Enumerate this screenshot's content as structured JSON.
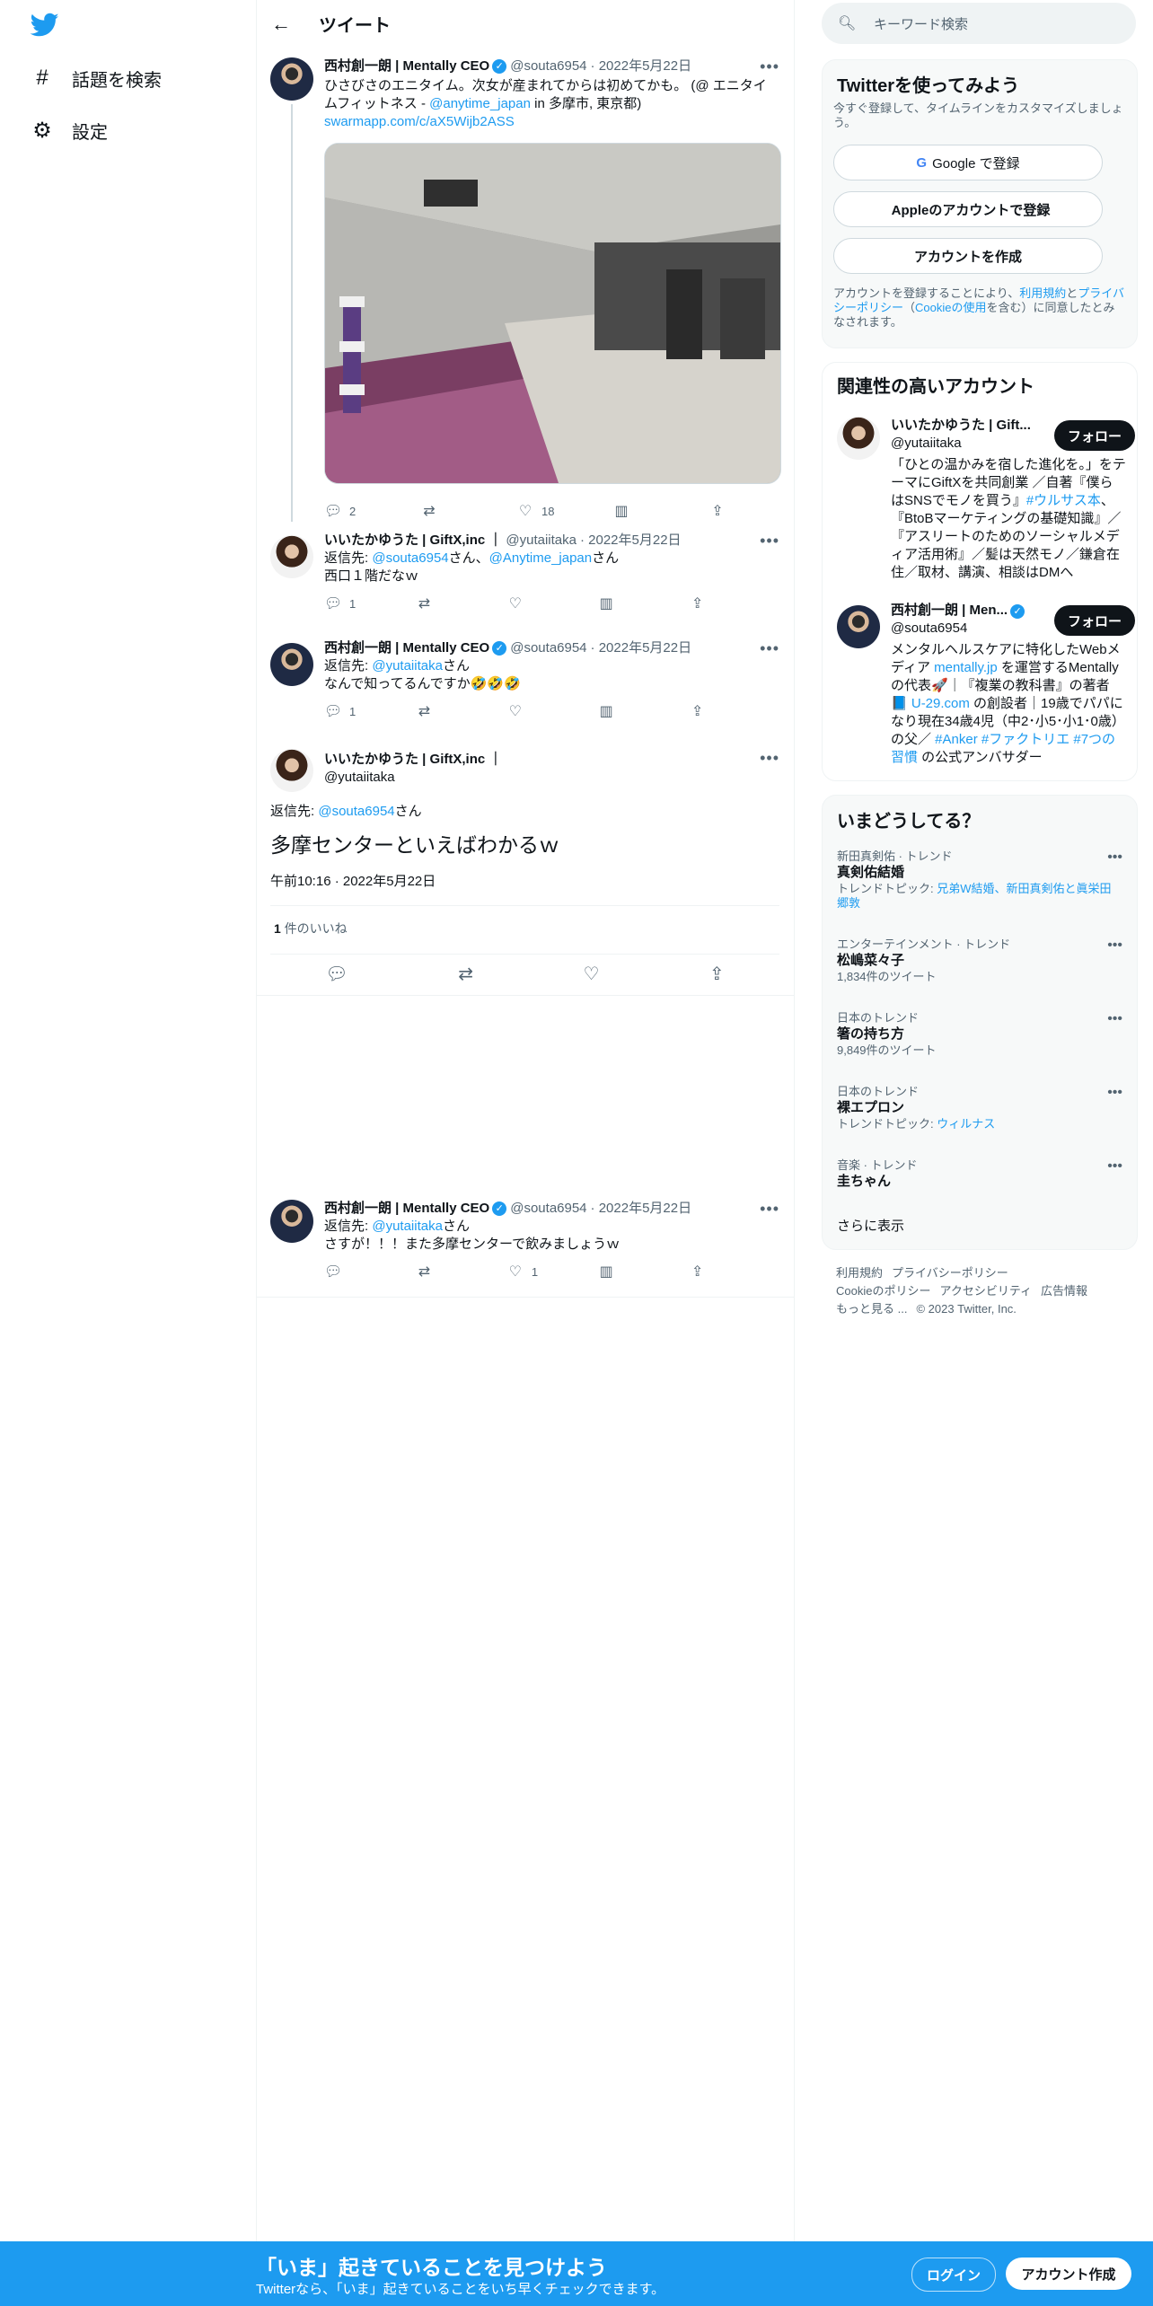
{
  "nav": {
    "items": [
      {
        "label": "話題を検索",
        "icon": "hashtag-icon"
      },
      {
        "label": "設定",
        "icon": "gear-icon"
      }
    ]
  },
  "header": {
    "title": "ツイート"
  },
  "tweets": [
    {
      "name": "西村創一朗 | Mentally CEO",
      "handle": "@souta6954",
      "date": "· 2022年5月22日",
      "text_1": "ひさびさのエニタイム。次女が産まれてからは初めてかも。 (@ エニタイムフィットネス - ",
      "mention": "@anytime_japan",
      "text_2": " in 多摩市, 東京都)",
      "link": "swarmapp.com/c/aX5Wijb2ASS",
      "reply_count": "2",
      "retweet_count": "",
      "like_count": "18"
    },
    {
      "name": "いいたかゆうた | GiftX,inc ｜",
      "handle": "@yutaiitaka",
      "date": "· 2022年5月22日",
      "reply_prefix": "返信先: ",
      "reply_to_1": "@souta6954",
      "reply_mid": "さん、",
      "reply_to_2": "@Anytime_japan",
      "reply_suffix": "さん",
      "text": "西口１階だなｗ",
      "reply_count": "1",
      "retweet_count": "",
      "like_count": ""
    },
    {
      "name": "西村創一朗 | Mentally CEO",
      "handle": "@souta6954",
      "date": "· 2022年5月22日",
      "reply_prefix": "返信先: ",
      "reply_to_1": "@yutaiitaka",
      "reply_suffix": "さん",
      "text": "なんで知ってるんですか🤣🤣🤣",
      "reply_count": "1",
      "retweet_count": "",
      "like_count": ""
    },
    {
      "name": "西村創一朗 | Mentally CEO",
      "handle": "@souta6954",
      "date": "· 2022年5月22日",
      "reply_prefix": "返信先: ",
      "reply_to_1": "@yutaiitaka",
      "reply_suffix": "さん",
      "text": "さすが！！！また多摩センターで飲みましょうｗ",
      "reply_count": "",
      "retweet_count": "",
      "like_count": "1"
    }
  ],
  "focus": {
    "name": "いいたかゆうた | GiftX,inc ｜",
    "handle": "@yutaiitaka",
    "reply_prefix": "返信先: ",
    "reply_to": "@souta6954",
    "reply_suffix": "さん",
    "text": "多摩センターといえばわかるｗ",
    "timestamp": "午前10:16 · 2022年5月22日",
    "like_count": "1",
    "like_label": " 件のいいね"
  },
  "sidebar": {
    "search_placeholder": "キーワード検索",
    "signup": {
      "title": "Twitterを使ってみよう",
      "subtitle": "今すぐ登録して、タイムラインをカスタマイズしましょう。",
      "google_label": "Google で登録",
      "apple_label": "Appleのアカウントで登録",
      "create_label": "アカウントを作成",
      "terms_1": "アカウントを登録することにより、",
      "terms_link_1": "利用規約",
      "terms_2": "と",
      "terms_link_2": "プライバシーポリシー",
      "terms_3": "（",
      "terms_link_3": "Cookieの使用",
      "terms_4": "を含む）に同意したとみなされます。"
    },
    "related": {
      "title": "関連性の高いアカウント",
      "follow_label": "フォロー",
      "accounts": [
        {
          "name": "いいたかゆうた | Gift...",
          "handle": "@yutaiitaka",
          "bio_1": "「ひとの温かみを宿した進化を。」をテーマにGiftXを共同創業 ／自著『僕らはSNSでモノを買う』",
          "bio_tag": "#ウルサス本",
          "bio_2": "、『BtoBマーケティングの基礎知識』／『アスリートのためのソーシャルメディア活用術』／髪は天然モノ／鎌倉在住／取材、講演、相談はDMへ"
        },
        {
          "name": "西村創一朗 | Men...",
          "handle": "@souta6954",
          "bio_1": "メンタルヘルスケアに特化したWebメディア ",
          "bio_link_1": "mentally.jp",
          "bio_2": " を運営するMentallyの代表🚀｜『複業の教科書』の著者📘 ",
          "bio_link_2": "U-29.com",
          "bio_3": " の創設者｜19歳でパパになり現在34歳4児（中2･小5･小1･0歳）の父／ ",
          "bio_tags": "#Anker #ファクトリエ #7つの習慣",
          "bio_4": " の公式アンバサダー"
        }
      ]
    },
    "trends": {
      "title": "いまどうしてる？",
      "items": [
        {
          "context": "新田真剣佑 · トレンド",
          "name": "真剣佑結婚",
          "sub_label": "トレンドトピック: ",
          "sub_link": "兄弟W結婚、新田真剣佑と眞栄田郷敦"
        },
        {
          "context": "エンターテインメント · トレンド",
          "name": "松嶋菜々子",
          "sub": "1,834件のツイート"
        },
        {
          "context": "日本のトレンド",
          "name": "箸の持ち方",
          "sub": "9,849件のツイート"
        },
        {
          "context": "日本のトレンド",
          "name": "裸エプロン",
          "sub_label": "トレンドトピック: ",
          "sub_link": "ウィルナス"
        },
        {
          "context": "音楽 · トレンド",
          "name": "圭ちゃん"
        }
      ],
      "show_more": "さらに表示"
    },
    "footer": {
      "links": [
        "利用規約",
        "プライバシーポリシー",
        "Cookieのポリシー",
        "アクセシビリティ",
        "広告情報",
        "もっと見る ..."
      ],
      "copyright": "© 2023 Twitter, Inc."
    }
  },
  "bottombar": {
    "title": "「いま」起きていることを見つけよう",
    "subtitle": "Twitterなら、「いま」起きていることをいち早くチェックできます。",
    "login_label": "ログイン",
    "signup_label": "アカウント作成"
  }
}
